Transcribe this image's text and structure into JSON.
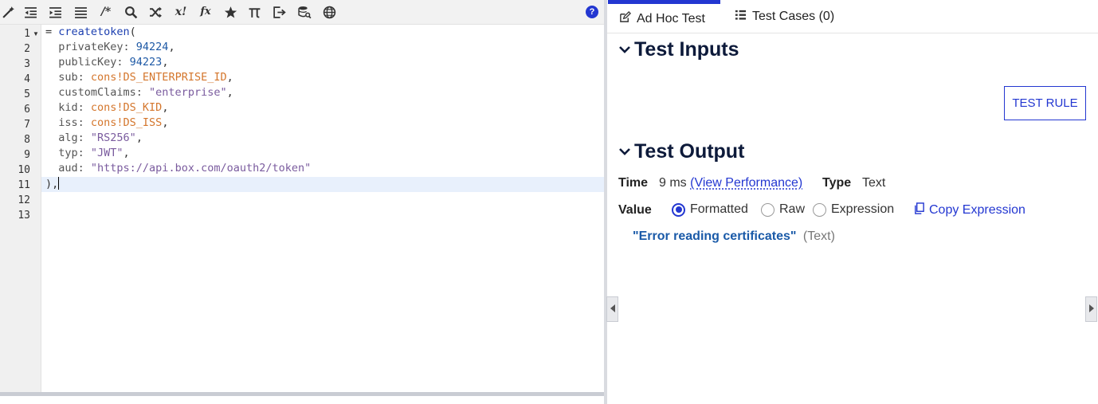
{
  "toolbar": {
    "icons": [
      "magic-wand-icon",
      "outdent-icon",
      "indent-icon",
      "format-list-icon",
      "comment-icon",
      "search-icon",
      "shuffle-icon",
      "variable-icon",
      "function-icon",
      "star-icon",
      "pi-icon",
      "export-icon",
      "database-search-icon",
      "globe-icon",
      "help-icon"
    ],
    "comment_label": "/*",
    "variable_label": "x!",
    "function_label": "fx",
    "help_label": "?"
  },
  "editor": {
    "line_numbers": [
      "1",
      "2",
      "3",
      "4",
      "5",
      "6",
      "7",
      "8",
      "9",
      "10",
      "11",
      "12",
      "13"
    ],
    "active_line": 11,
    "lines": {
      "l1": {
        "eq": "= ",
        "fn": "createtoken",
        "paren": "("
      },
      "l2": {
        "key": "  privateKey: ",
        "value": "94224",
        "tail": ","
      },
      "l3": {
        "key": "  publicKey: ",
        "value": "94223",
        "tail": ","
      },
      "l4": {
        "key": "  sub: ",
        "value": "cons!DS_ENTERPRISE_ID",
        "tail": ","
      },
      "l5": {
        "key": "  customClaims: ",
        "value": "\"enterprise\"",
        "tail": ","
      },
      "l6": {
        "key": "  kid: ",
        "value": "cons!DS_KID",
        "tail": ","
      },
      "l7": {
        "key": "  iss: ",
        "value": "cons!DS_ISS",
        "tail": ","
      },
      "l8": {
        "key": "  alg: ",
        "value": "\"RS256\"",
        "tail": ","
      },
      "l9": {
        "key": "  typ: ",
        "value": "\"JWT\"",
        "tail": ","
      },
      "l10": {
        "key": "  aud: ",
        "value": "\"https://api.box.com/oauth2/token\"",
        "tail": ""
      },
      "l11": {
        "text": "),"
      }
    }
  },
  "tabs": [
    {
      "label": "Ad Hoc Test",
      "active": true,
      "icon": "edit-icon"
    },
    {
      "label": "Test Cases (0)",
      "active": false,
      "icon": "list-icon"
    }
  ],
  "test_inputs": {
    "title": "Test Inputs",
    "test_rule_label": "TEST RULE"
  },
  "test_output": {
    "title": "Test Output",
    "time_label": "Time",
    "time_value": "9 ms",
    "view_performance": "(View Performance)",
    "type_label": "Type",
    "type_value": "Text",
    "value_label": "Value",
    "radio_options": [
      {
        "label": "Formatted",
        "checked": true
      },
      {
        "label": "Raw",
        "checked": false
      },
      {
        "label": "Expression",
        "checked": false
      }
    ],
    "copy_expression": "Copy Expression",
    "result_string": "\"Error reading certificates\"",
    "result_type": "(Text)"
  },
  "colors": {
    "accent": "#2337d1",
    "result": "#1a5aa8",
    "constant": "#d4762c",
    "string": "#7a5b9e"
  }
}
